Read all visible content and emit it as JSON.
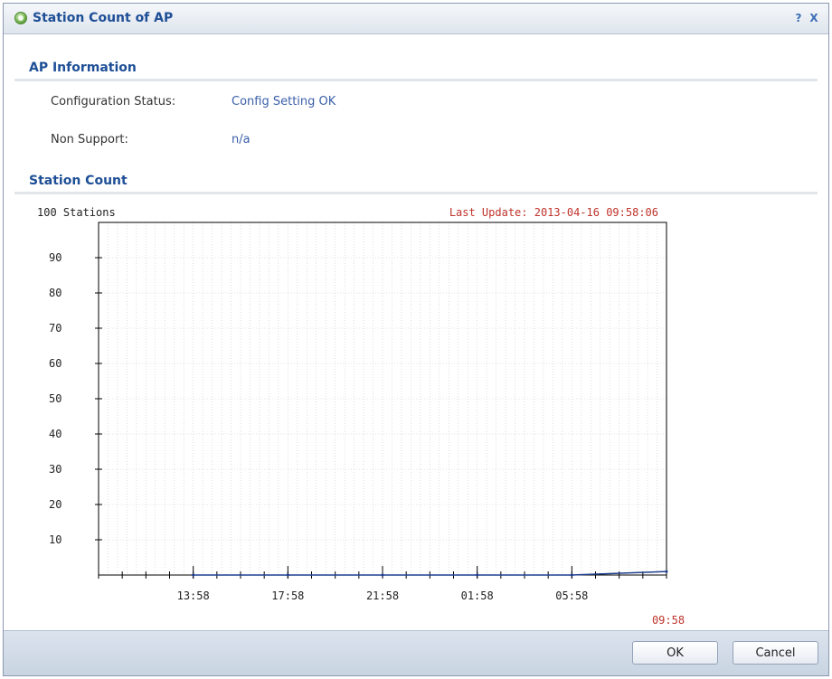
{
  "dialog": {
    "title": "Station Count of AP",
    "help": "?",
    "close": "X"
  },
  "ap_info": {
    "heading": "AP Information",
    "rows": [
      {
        "label": "Configuration Status:",
        "value": "Config Setting OK"
      },
      {
        "label": "Non Support:",
        "value": "n/a"
      }
    ]
  },
  "station_count": {
    "heading": "Station Count"
  },
  "chart_data": {
    "type": "line",
    "y_max_label": "100 Stations",
    "last_update": "Last Update: 2013-04-16 09:58:06",
    "y_ticks": [
      90,
      80,
      70,
      60,
      50,
      40,
      30,
      20,
      10
    ],
    "ylim": [
      0,
      100
    ],
    "x_tick_labels": [
      "13:58",
      "17:58",
      "21:58",
      "01:58",
      "05:58"
    ],
    "x_end_label": "09:58",
    "grid": true,
    "series": [
      {
        "color": "#1f3f8f",
        "x": [
          "13:58",
          "17:58",
          "21:58",
          "01:58",
          "05:58",
          "09:58"
        ],
        "values": [
          0,
          0,
          0,
          0,
          0,
          1
        ]
      }
    ],
    "colors": {
      "axis": "#000000",
      "grid": "#c8c8c8",
      "accent": "#c0332b",
      "line": "#1f3f8f"
    }
  },
  "footer": {
    "ok": "OK",
    "cancel": "Cancel"
  }
}
